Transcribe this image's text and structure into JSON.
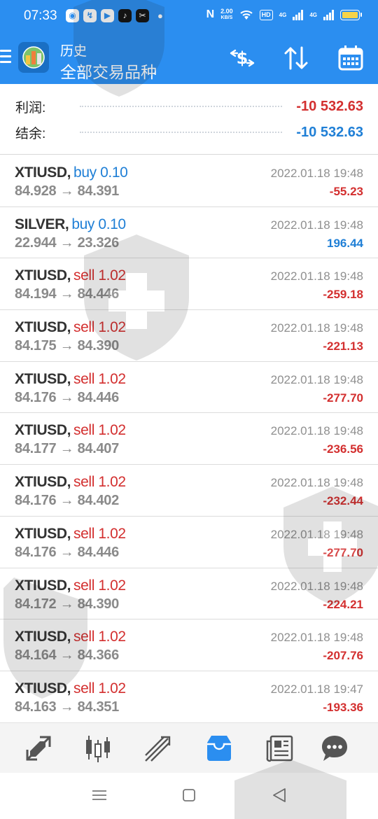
{
  "status_bar": {
    "time": "07:33",
    "apps": [
      "◉",
      "↯",
      "▶",
      "♪",
      "✂"
    ],
    "speed_top": "2.00",
    "speed_unit": "KB/S",
    "hd": "HD",
    "net1": "4G",
    "net2": "4G"
  },
  "app_bar": {
    "title_small": "历史",
    "title_large": "全部交易品种",
    "icons": [
      "menu-icon",
      "logo",
      "dollar-sort-icon",
      "sort-arrows-icon",
      "calendar-icon"
    ]
  },
  "summary": {
    "profit_label": "利润:",
    "profit_value": "-10 532.63",
    "balance_label": "结余:",
    "balance_value": "-10 532.63"
  },
  "trades": [
    {
      "symbol": "XTIUSD,",
      "side": "buy",
      "volume": "buy 0.10",
      "prices": "84.928 → 84.391",
      "time": "2022.01.18 19:48",
      "profit": "-55.23"
    },
    {
      "symbol": "SILVER,",
      "side": "buy",
      "volume": "buy 0.10",
      "prices": "22.944 → 23.326",
      "time": "2022.01.18 19:48",
      "profit": "196.44"
    },
    {
      "symbol": "XTIUSD,",
      "side": "sell",
      "volume": "sell 1.02",
      "prices": "84.194 → 84.446",
      "time": "2022.01.18 19:48",
      "profit": "-259.18"
    },
    {
      "symbol": "XTIUSD,",
      "side": "sell",
      "volume": "sell 1.02",
      "prices": "84.175 → 84.390",
      "time": "2022.01.18 19:48",
      "profit": "-221.13"
    },
    {
      "symbol": "XTIUSD,",
      "side": "sell",
      "volume": "sell 1.02",
      "prices": "84.176 → 84.446",
      "time": "2022.01.18 19:48",
      "profit": "-277.70"
    },
    {
      "symbol": "XTIUSD,",
      "side": "sell",
      "volume": "sell 1.02",
      "prices": "84.177 → 84.407",
      "time": "2022.01.18 19:48",
      "profit": "-236.56"
    },
    {
      "symbol": "XTIUSD,",
      "side": "sell",
      "volume": "sell 1.02",
      "prices": "84.176 → 84.402",
      "time": "2022.01.18 19:48",
      "profit": "-232.44"
    },
    {
      "symbol": "XTIUSD,",
      "side": "sell",
      "volume": "sell 1.02",
      "prices": "84.176 → 84.446",
      "time": "2022.01.18 19:48",
      "profit": "-277.70"
    },
    {
      "symbol": "XTIUSD,",
      "side": "sell",
      "volume": "sell 1.02",
      "prices": "84.172 → 84.390",
      "time": "2022.01.18 19:48",
      "profit": "-224.21"
    },
    {
      "symbol": "XTIUSD,",
      "side": "sell",
      "volume": "sell 1.02",
      "prices": "84.164 → 84.366",
      "time": "2022.01.18 19:48",
      "profit": "-207.76"
    },
    {
      "symbol": "XTIUSD,",
      "side": "sell",
      "volume": "sell 1.02",
      "prices": "84.163 → 84.351",
      "time": "2022.01.18 19:47",
      "profit": "-193.36"
    }
  ],
  "bottom_nav": [
    "quotes-icon",
    "chart-icon",
    "trade-icon",
    "history-icon",
    "news-icon",
    "chat-icon"
  ],
  "bottom_nav_active": "history-icon",
  "system_nav": [
    "recents-icon",
    "home-icon",
    "back-icon"
  ],
  "colors": {
    "header": "#2b8ef0",
    "negative": "#d32f2f",
    "positive": "#1f7fd6",
    "muted": "#8a8a8a"
  }
}
